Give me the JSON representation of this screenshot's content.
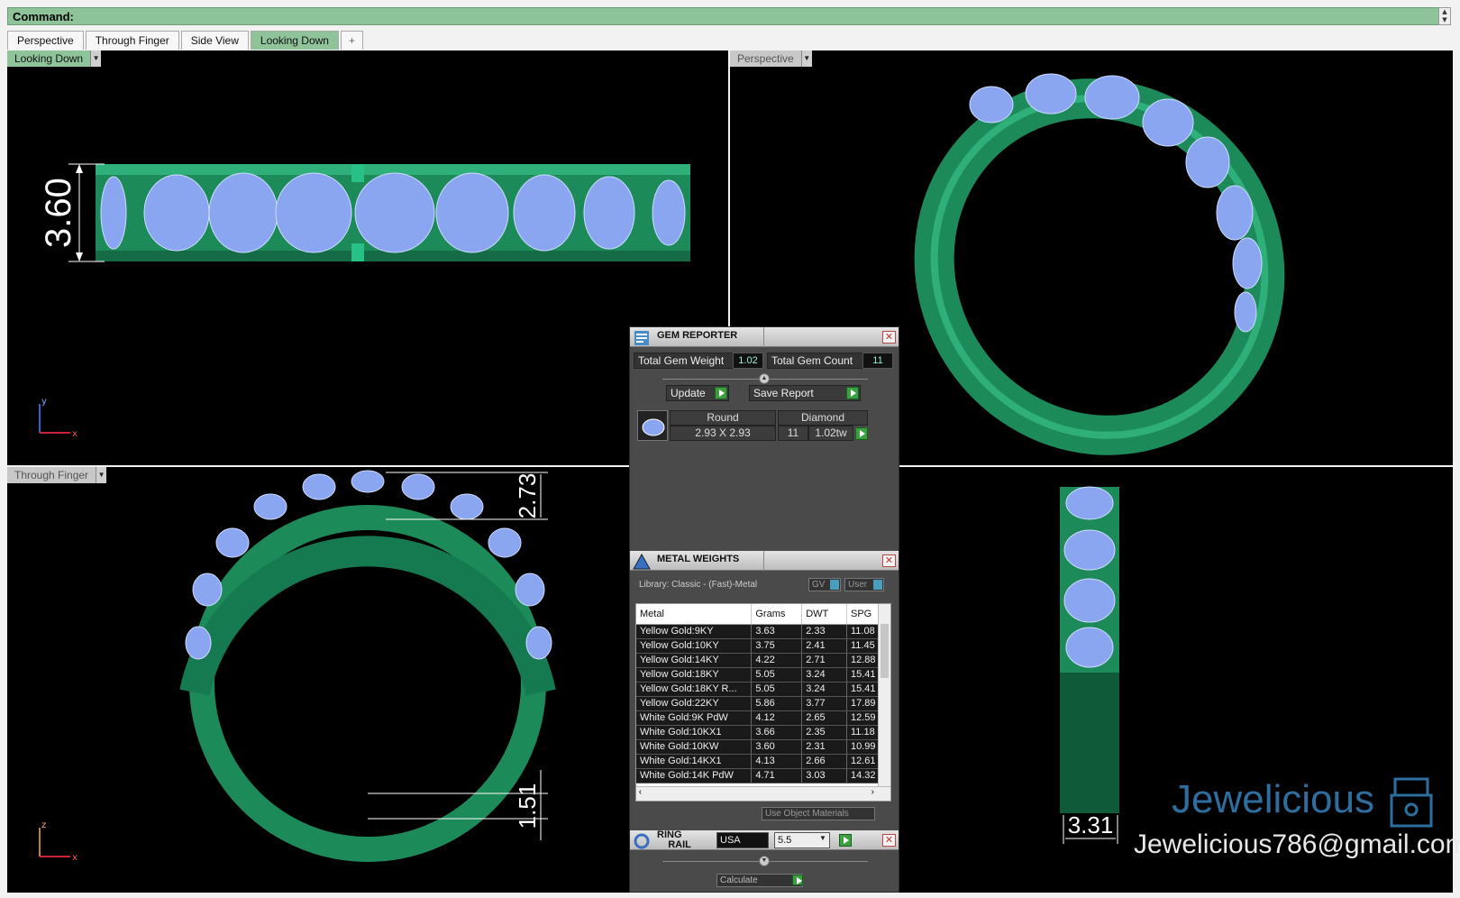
{
  "command": {
    "label": "Command:"
  },
  "tabs": [
    "Perspective",
    "Through Finger",
    "Side View",
    "Looking Down",
    "+"
  ],
  "active_tab": "Looking Down",
  "viewports": {
    "top_left": {
      "label": "Looking Down",
      "dimension": "3.60",
      "axis_a": "y",
      "axis_b": "x"
    },
    "top_right": {
      "label": "Perspective"
    },
    "bottom_left": {
      "label": "Through Finger",
      "dim_top": "2.73",
      "dim_bottom": "1.51",
      "axis_a": "z",
      "axis_b": "x"
    },
    "bottom_right": {
      "dimension": "3.31"
    }
  },
  "gem_reporter": {
    "title": "GEM REPORTER",
    "total_weight_label": "Total Gem Weight",
    "total_weight": "1.02",
    "total_count_label": "Total Gem Count",
    "total_count": "11",
    "update_label": "Update",
    "save_label": "Save Report",
    "gem": {
      "shape": "Round",
      "type": "Diamond",
      "size": "2.93 X 2.93",
      "count": "11",
      "weight": "1.02tw"
    }
  },
  "metal_weights": {
    "title": "METAL WEIGHTS",
    "library": "Library: Classic - (Fast)-Metal",
    "gv": "GV",
    "user": "User",
    "columns": [
      "Metal",
      "Grams",
      "DWT",
      "SPG"
    ],
    "rows": [
      [
        "Yellow Gold:9KY",
        "3.63",
        "2.33",
        "11.08"
      ],
      [
        "Yellow Gold:10KY",
        "3.75",
        "2.41",
        "11.45"
      ],
      [
        "Yellow Gold:14KY",
        "4.22",
        "2.71",
        "12.88"
      ],
      [
        "Yellow Gold:18KY",
        "5.05",
        "3.24",
        "15.41"
      ],
      [
        "Yellow Gold:18KY R...",
        "5.05",
        "3.24",
        "15.41"
      ],
      [
        "Yellow Gold:22KY",
        "5.86",
        "3.77",
        "17.89"
      ],
      [
        "White Gold:9K PdW",
        "4.12",
        "2.65",
        "12.59"
      ],
      [
        "White Gold:10KX1",
        "3.66",
        "2.35",
        "11.18"
      ],
      [
        "White Gold:10KW",
        "3.60",
        "2.31",
        "10.99"
      ],
      [
        "White Gold:14KX1",
        "4.13",
        "2.66",
        "12.61"
      ],
      [
        "White Gold:14K PdW",
        "4.71",
        "3.03",
        "14.32"
      ]
    ],
    "use_object": "Use Object Materials"
  },
  "ring_rail": {
    "title_a": "RING",
    "title_b": "RAIL",
    "region": "USA",
    "size": "5.5",
    "calculate": "Calculate"
  },
  "watermark": {
    "brand": "Jewelicious",
    "email": "Jewelicious786@gmail.com"
  },
  "colors": {
    "accent": "#8fc39a",
    "metal": "#1f8a5a",
    "gem": "#8aa6f0"
  }
}
